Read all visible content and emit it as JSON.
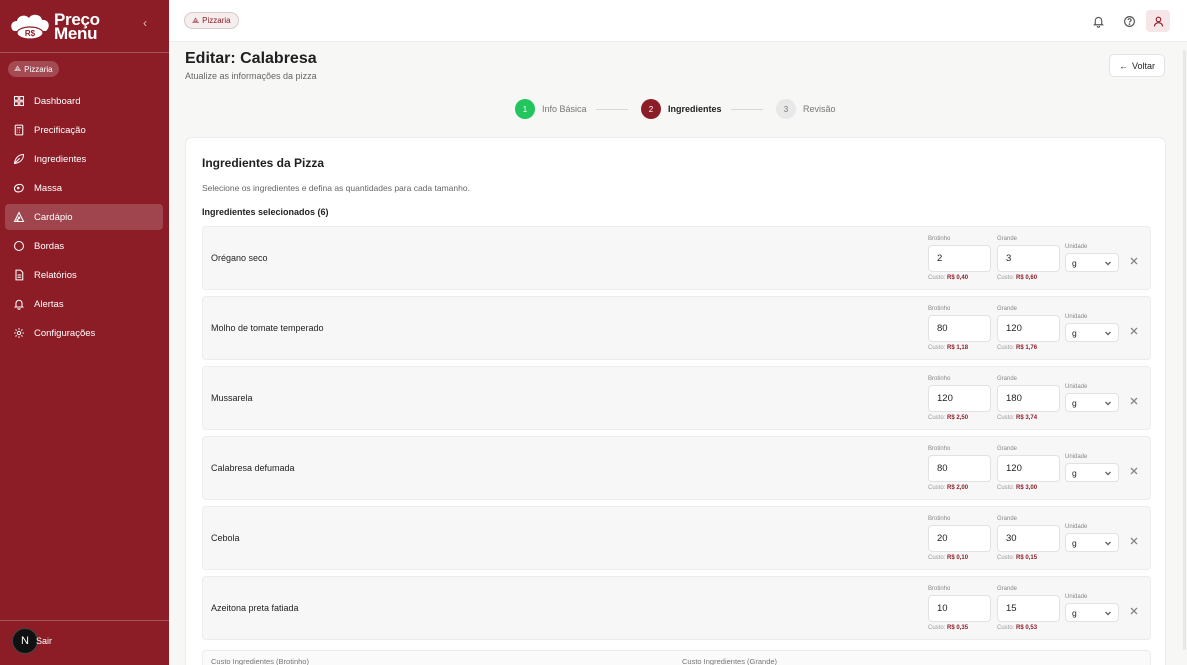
{
  "brand": {
    "line1": "Preço",
    "line2": "Menu",
    "badge": "R$"
  },
  "context_badge": "Pizzaria",
  "sidebar": {
    "items": [
      {
        "label": "Dashboard",
        "icon": "dashboard-icon",
        "active": false
      },
      {
        "label": "Precificação",
        "icon": "calculator-icon",
        "active": false
      },
      {
        "label": "Ingredientes",
        "icon": "leaf-icon",
        "active": false
      },
      {
        "label": "Massa",
        "icon": "dough-icon",
        "active": false
      },
      {
        "label": "Cardápio",
        "icon": "pizza-icon",
        "active": true
      },
      {
        "label": "Bordas",
        "icon": "circle-icon",
        "active": false
      },
      {
        "label": "Relatórios",
        "icon": "report-icon",
        "active": false
      },
      {
        "label": "Alertas",
        "icon": "bell-icon",
        "active": false
      },
      {
        "label": "Configurações",
        "icon": "gear-icon",
        "active": false
      }
    ],
    "logout": "Sair",
    "avatar_initial": "N"
  },
  "header": {
    "title": "Editar: Calabresa",
    "subtitle": "Atualize as informações da pizza",
    "back": "Voltar"
  },
  "steps": [
    {
      "num": "1",
      "label": "Info Básica",
      "state": "done"
    },
    {
      "num": "2",
      "label": "Ingredientes",
      "state": "active"
    },
    {
      "num": "3",
      "label": "Revisão",
      "state": "todo"
    }
  ],
  "card": {
    "title": "Ingredientes da Pizza",
    "description": "Selecione os ingredientes e defina as quantidades para cada tamanho.",
    "selected_label": "Ingredientes selecionados (6)",
    "small_label": "Brotinho",
    "large_label": "Grande",
    "unit_label": "Unidade",
    "cost_prefix": "Custo:"
  },
  "ingredients": [
    {
      "name": "Orégano seco",
      "small": "2",
      "large": "3",
      "small_cost": "R$ 0,40",
      "large_cost": "R$ 0,60",
      "unit": "g"
    },
    {
      "name": "Molho de tomate temperado",
      "small": "80",
      "large": "120",
      "small_cost": "R$ 1,18",
      "large_cost": "R$ 1,76",
      "unit": "g"
    },
    {
      "name": "Mussarela",
      "small": "120",
      "large": "180",
      "small_cost": "R$ 2,50",
      "large_cost": "R$ 3,74",
      "unit": "g"
    },
    {
      "name": "Calabresa defumada",
      "small": "80",
      "large": "120",
      "small_cost": "R$ 2,00",
      "large_cost": "R$ 3,00",
      "unit": "g"
    },
    {
      "name": "Cebola",
      "small": "20",
      "large": "30",
      "small_cost": "R$ 0,10",
      "large_cost": "R$ 0,15",
      "unit": "g"
    },
    {
      "name": "Azeitona preta fatiada",
      "small": "10",
      "large": "15",
      "small_cost": "R$ 0,35",
      "large_cost": "R$ 0,53",
      "unit": "g"
    }
  ],
  "totals": {
    "small_label": "Custo Ingredientes (Brotinho)",
    "large_label": "Custo Ingredientes (Grande)"
  },
  "colors": {
    "brand": "#8c1d27",
    "success": "#22c55e"
  }
}
